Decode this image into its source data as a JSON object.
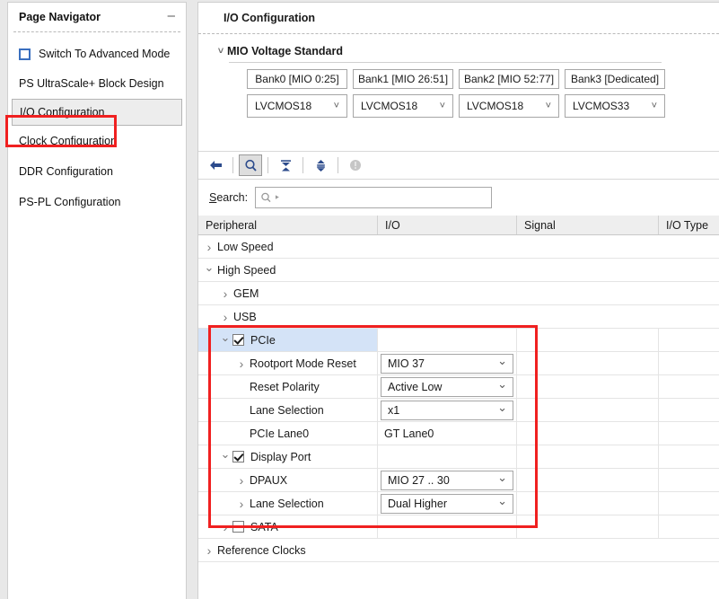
{
  "navigator": {
    "title": "Page Navigator",
    "minimize_icon": "minimize-icon",
    "advanced_mode": {
      "label": "Switch To Advanced Mode",
      "checked": false
    },
    "items": [
      {
        "label": "PS UltraScale+ Block Design",
        "selected": false
      },
      {
        "label": "I/O Configuration",
        "selected": true
      },
      {
        "label": "Clock Configuration",
        "selected": false
      },
      {
        "label": "DDR Configuration",
        "selected": false
      },
      {
        "label": "PS-PL Configuration",
        "selected": false
      }
    ]
  },
  "main": {
    "header_title": "I/O Configuration",
    "mio_voltage": {
      "group_label": "MIO Voltage Standard",
      "expanded": true,
      "banks": [
        {
          "name": "Bank0 [MIO 0:25]",
          "standard": "LVCMOS18"
        },
        {
          "name": "Bank1 [MIO 26:51]",
          "standard": "LVCMOS18"
        },
        {
          "name": "Bank2 [MIO 52:77]",
          "standard": "LVCMOS18"
        },
        {
          "name": "Bank3 [Dedicated]",
          "standard": "LVCMOS33"
        }
      ]
    },
    "toolbar": [
      {
        "name": "back-arrow-icon",
        "active": false,
        "disabled": false
      },
      {
        "name": "search-icon",
        "active": true,
        "disabled": false
      },
      {
        "name": "collapse-all-icon",
        "active": false,
        "disabled": false
      },
      {
        "name": "expand-all-icon",
        "active": false,
        "disabled": false
      },
      {
        "name": "info-icon",
        "active": false,
        "disabled": true
      }
    ],
    "search": {
      "label": "Search:",
      "label_mnemonic": "S",
      "label_rest": "earch:",
      "value": "",
      "placeholder": "Q-",
      "icon": "search-icon"
    },
    "table": {
      "columns": [
        "Peripheral",
        "I/O",
        "Signal",
        "I/O Type"
      ],
      "rows": [
        {
          "label": "Low Speed",
          "indent": 0,
          "twisty": "collapsed",
          "checkbox": null,
          "io": null,
          "io_type": "plain",
          "group": true,
          "selected": false
        },
        {
          "label": "High Speed",
          "indent": 0,
          "twisty": "expanded",
          "checkbox": null,
          "io": null,
          "io_type": "plain",
          "group": true,
          "selected": false
        },
        {
          "label": "GEM",
          "indent": 1,
          "twisty": "collapsed",
          "checkbox": null,
          "io": null,
          "io_type": "plain",
          "group": true,
          "selected": false
        },
        {
          "label": "USB",
          "indent": 1,
          "twisty": "collapsed",
          "checkbox": null,
          "io": null,
          "io_type": "plain",
          "group": true,
          "selected": false
        },
        {
          "label": "PCIe",
          "indent": 1,
          "twisty": "expanded",
          "checkbox": true,
          "io": null,
          "io_type": "plain",
          "group": false,
          "selected": true
        },
        {
          "label": "Rootport Mode Reset",
          "indent": 2,
          "twisty": "collapsed",
          "checkbox": null,
          "io": "MIO 37",
          "io_type": "select",
          "group": false,
          "selected": false
        },
        {
          "label": "Reset Polarity",
          "indent": 2,
          "twisty": "none",
          "checkbox": null,
          "io": "Active Low",
          "io_type": "select",
          "group": false,
          "selected": false
        },
        {
          "label": "Lane Selection",
          "indent": 2,
          "twisty": "none",
          "checkbox": null,
          "io": "x1",
          "io_type": "select",
          "group": false,
          "selected": false
        },
        {
          "label": "PCIe Lane0",
          "indent": 2,
          "twisty": "none",
          "checkbox": null,
          "io": "GT Lane0",
          "io_type": "plain",
          "group": false,
          "selected": false
        },
        {
          "label": "Display Port",
          "indent": 1,
          "twisty": "expanded",
          "checkbox": true,
          "io": null,
          "io_type": "plain",
          "group": false,
          "selected": false
        },
        {
          "label": "DPAUX",
          "indent": 2,
          "twisty": "collapsed",
          "checkbox": null,
          "io": "MIO 27 .. 30",
          "io_type": "select",
          "group": false,
          "selected": false
        },
        {
          "label": "Lane Selection",
          "indent": 2,
          "twisty": "collapsed",
          "checkbox": null,
          "io": "Dual Higher",
          "io_type": "select",
          "group": false,
          "selected": false
        },
        {
          "label": "SATA",
          "indent": 1,
          "twisty": "collapsed",
          "checkbox": false,
          "io": null,
          "io_type": "plain",
          "group": false,
          "selected": false
        },
        {
          "label": "Reference Clocks",
          "indent": 0,
          "twisty": "collapsed",
          "checkbox": null,
          "io": null,
          "io_type": "plain",
          "group": true,
          "selected": false
        }
      ]
    }
  },
  "annotations": {
    "nav_highlight_color": "#f02020",
    "tree_highlight_color": "#f02020",
    "selection_color": "#d4e3f7"
  },
  "watermark": {
    "text": ""
  }
}
